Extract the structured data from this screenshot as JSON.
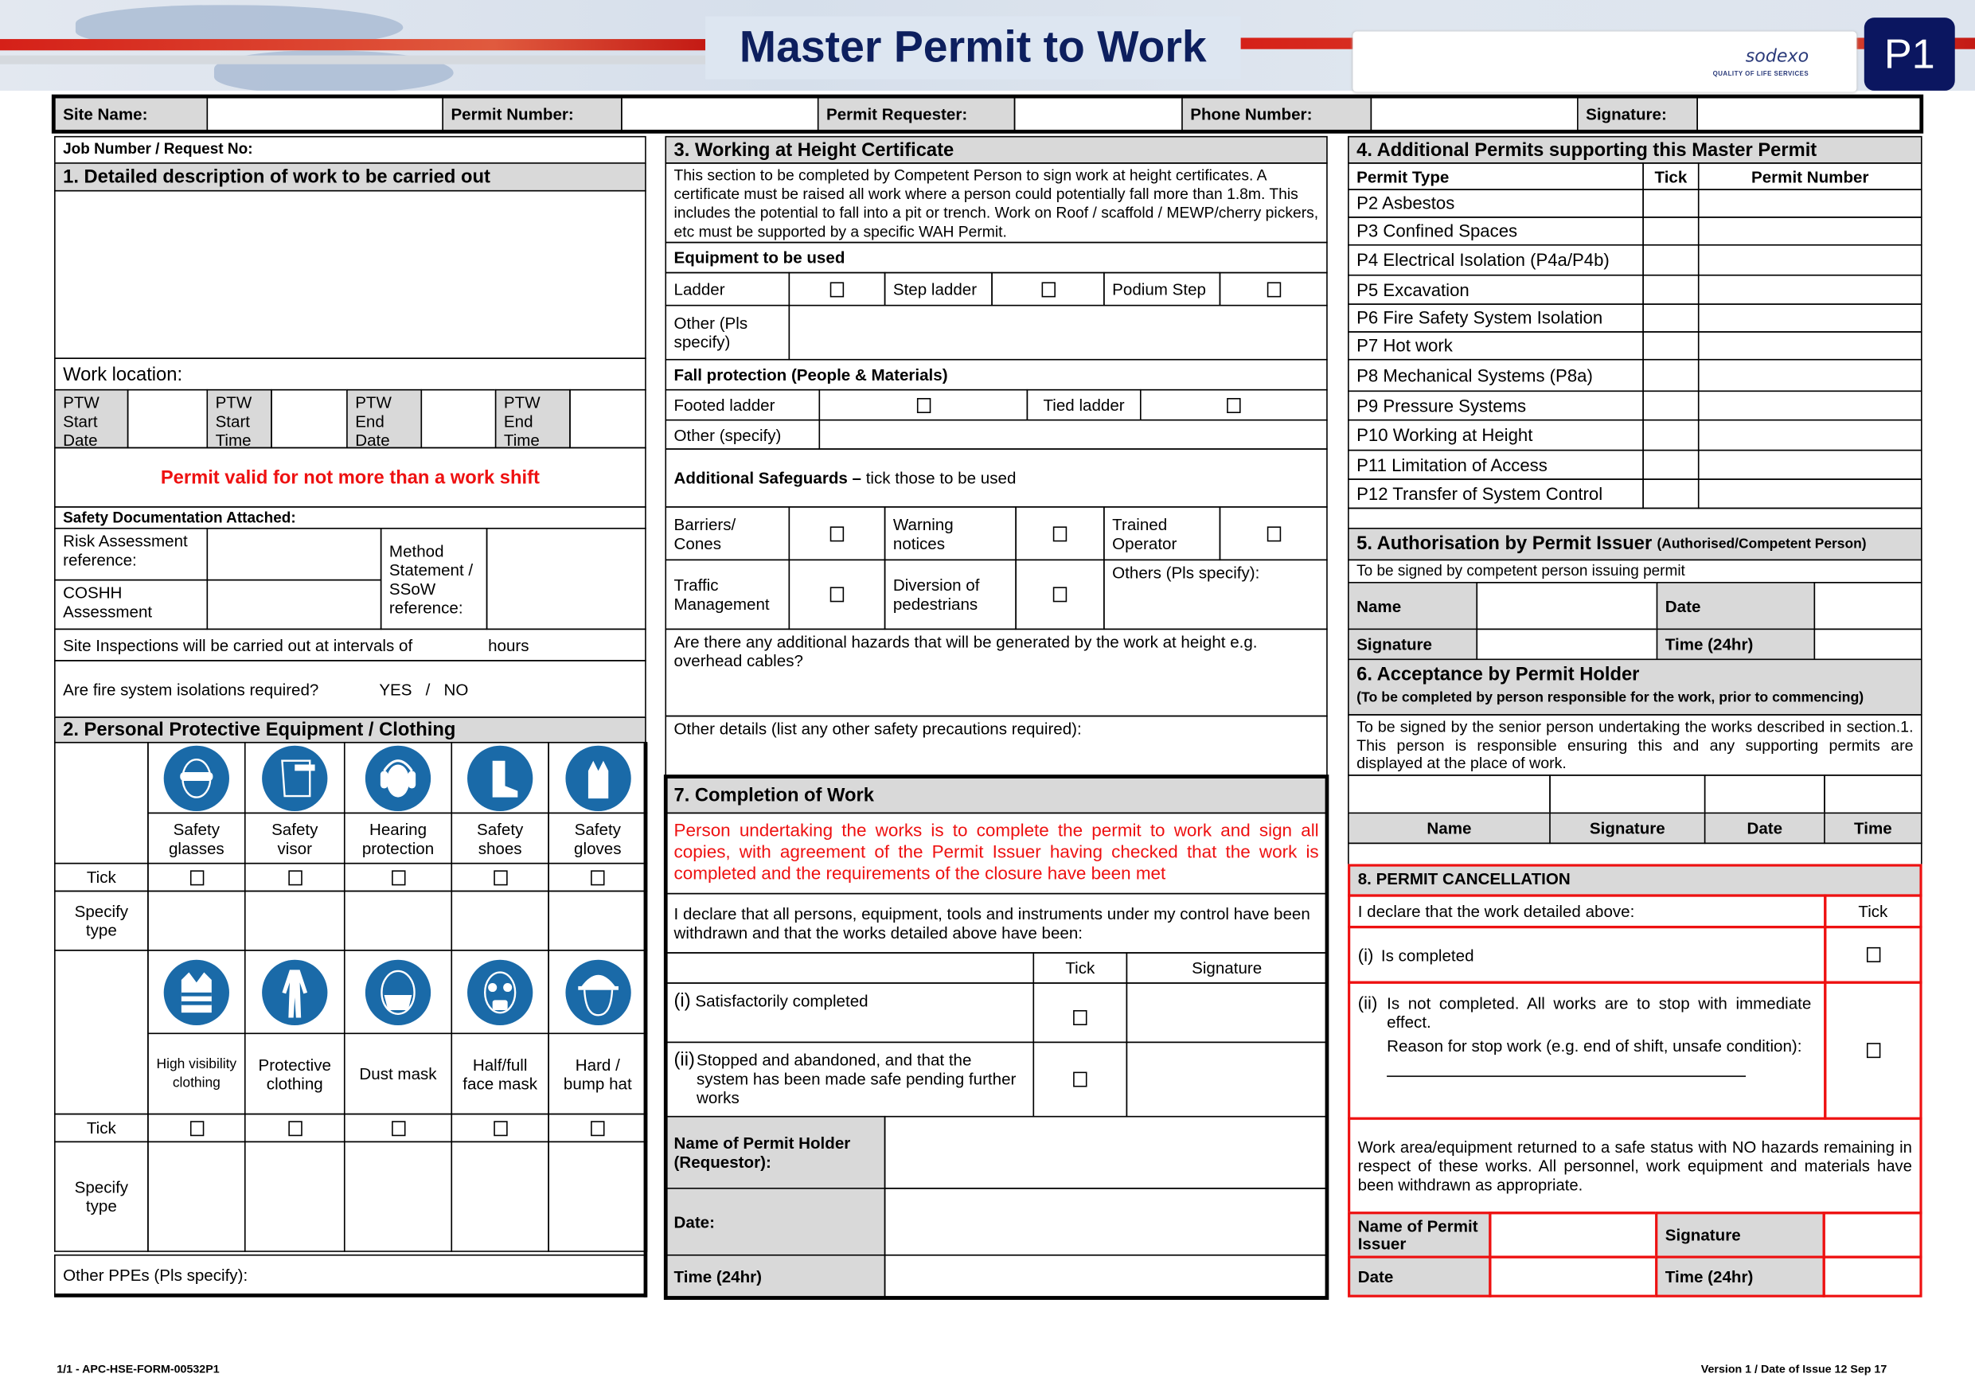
{
  "header": {
    "title": "Master Permit to Work",
    "logo_word": "sodexo",
    "logo_tagline": "QUALITY OF LIFE SERVICES",
    "badge": "P1"
  },
  "top_row": {
    "site_name_label": "Site Name:",
    "permit_number_label": "Permit Number:",
    "permit_requester_label": "Permit Requester:",
    "phone_number_label": "Phone Number:",
    "signature_label": "Signature:"
  },
  "section1": {
    "job_number_label": "Job Number / Request No:",
    "title": "1. Detailed description of work to be carried out",
    "work_location_label": "Work location:",
    "ptw": [
      "PTW Start Date",
      "PTW Start Time",
      "PTW End Date",
      "PTW End Time"
    ],
    "validity_notice": "Permit valid for not more than a work shift",
    "safety_docs_label": "Safety Documentation Attached:",
    "risk_assessment_label": "Risk Assessment reference:",
    "coshh_label": "COSHH Assessment",
    "method_statement_label": "Method Statement / SSoW reference:",
    "site_inspections_label": "Site Inspections will be carried out at intervals of",
    "hours_label": "hours",
    "fire_isolation_question": "Are fire system isolations required?",
    "yes_no": "YES   /   NO"
  },
  "section2": {
    "title": "2. Personal Protective Equipment / Clothing",
    "tick_label": "Tick",
    "specify_label": "Specify type",
    "row1": [
      {
        "label": "Safety glasses",
        "icon": "safety-glasses-icon"
      },
      {
        "label": "Safety visor",
        "icon": "safety-visor-icon"
      },
      {
        "label": "Hearing protection",
        "icon": "hearing-protection-icon"
      },
      {
        "label": "Safety shoes",
        "icon": "safety-shoes-icon"
      },
      {
        "label": "Safety gloves",
        "icon": "safety-gloves-icon"
      }
    ],
    "row2": [
      {
        "label": "High visibility clothing",
        "icon": "hi-vis-vest-icon"
      },
      {
        "label": "Protective clothing",
        "icon": "coverall-icon"
      },
      {
        "label": "Dust mask",
        "icon": "dust-mask-icon"
      },
      {
        "label": "Half/full face mask",
        "icon": "respirator-icon"
      },
      {
        "label": "Hard / bump hat",
        "icon": "hard-hat-icon"
      }
    ],
    "other_ppe_label": "Other PPEs (Pls specify):"
  },
  "section3": {
    "title": "3. Working at Height Certificate",
    "intro": "This section to be completed by Competent Person to sign work at height certificates. A certificate must be raised all work where a person could potentially fall more than 1.8m. This includes the potential to fall into a pit or trench. Work on Roof / scaffold / MEWP/cherry pickers, etc must be supported by a specific WAH Permit.",
    "equipment_label": "Equipment to be used",
    "equipment": [
      "Ladder",
      "Step ladder",
      "Podium Step"
    ],
    "other_pls_specify": "Other (Pls specify)",
    "fall_protection_label": "Fall protection (People & Materials)",
    "fall_protection": [
      "Footed ladder",
      "Tied ladder"
    ],
    "other_specify": "Other (specify)",
    "safeguards_bold": "Additional Safeguards –",
    "safeguards_rest": " tick those to be used",
    "safeguards_row1": [
      "Barriers/ Cones",
      "Warning notices",
      "Trained Operator"
    ],
    "safeguards_row2": [
      "Traffic Management",
      "Diversion of pedestrians"
    ],
    "others_pls_specify": "Others (Pls specify):",
    "hazards_question": "Are there any additional hazards that will be generated by the work at height e.g. overhead cables?",
    "other_details": "Other details (list any other safety precautions required):"
  },
  "section4": {
    "title": "4. Additional Permits supporting this Master Permit",
    "col_type": "Permit Type",
    "col_tick": "Tick",
    "col_number": "Permit Number",
    "permits": [
      "P2 Asbestos",
      "P3 Confined Spaces",
      "P4 Electrical Isolation (P4a/P4b)",
      "P5 Excavation",
      "P6 Fire Safety System Isolation",
      "P7 Hot work",
      "P8 Mechanical Systems (P8a)",
      "P9 Pressure Systems",
      "P10 Working at Height",
      "P11 Limitation of Access",
      "P12 Transfer of System Control"
    ]
  },
  "section5": {
    "title": "5. Authorisation by Permit Issuer",
    "title_suffix": "(Authorised/Competent Person)",
    "subtitle": "To be signed by competent person issuing permit",
    "name_label": "Name",
    "date_label": "Date",
    "signature_label": "Signature",
    "time_label": "Time (24hr)"
  },
  "section6": {
    "title": "6. Acceptance by Permit Holder",
    "subtitle": "(To be completed by person responsible for the work, prior to commencing)",
    "body": "To be signed by the senior person undertaking the works described in section.1. This person is responsible ensuring this and any supporting permits are displayed at the place of work.",
    "columns": [
      "Name",
      "Signature",
      "Date",
      "Time"
    ]
  },
  "section7": {
    "title": "7. Completion of Work",
    "red_notice": "Person undertaking the works is to complete the permit to work and sign all copies, with agreement of the Permit Issuer having checked that the work is completed and  the requirements of the closure have been met",
    "declaration": "I declare that all persons, equipment, tools and instruments under my control have been withdrawn and that the works detailed above have been:",
    "col_tick": "Tick",
    "col_signature": "Signature",
    "opt1_num": "(i)",
    "opt1": "Satisfactorily completed",
    "opt2_num": "(ii)",
    "opt2": "Stopped and abandoned, and that the system has been made safe pending further works",
    "holder_name_label": "Name of Permit Holder (Requestor):",
    "date_label": "Date:",
    "time_label": "Time (24hr)"
  },
  "section8": {
    "title": "8. PERMIT CANCELLATION",
    "declare": "I declare that the work detailed above:",
    "tick_label": "Tick",
    "opt1_num": "(i)",
    "opt1": "Is completed",
    "opt2_num": "(ii)",
    "opt2": "Is not completed. All works are to stop with immediate effect.",
    "reason": "Reason for stop work (e.g. end of shift, unsafe condition):",
    "safe_status": "Work area/equipment returned to a safe status with NO hazards remaining in respect of these works. All personnel, work equipment and materials have been withdrawn as appropriate.",
    "issuer_name_label": "Name of Permit Issuer",
    "signature_label": "Signature",
    "date_label": "Date",
    "time_label": "Time (24hr)"
  },
  "footer": {
    "left": "1/1 - APC-HSE-FORM-00532P1",
    "right": "Version 1 / Date of Issue 12 Sep 17"
  },
  "colors": {
    "brand_navy": "#0d1f5e",
    "badge_navy": "#0b1660",
    "alert_red": "#ee1111",
    "header_gray": "#d9d9d9",
    "ppe_blue": "#1a6aa8"
  }
}
